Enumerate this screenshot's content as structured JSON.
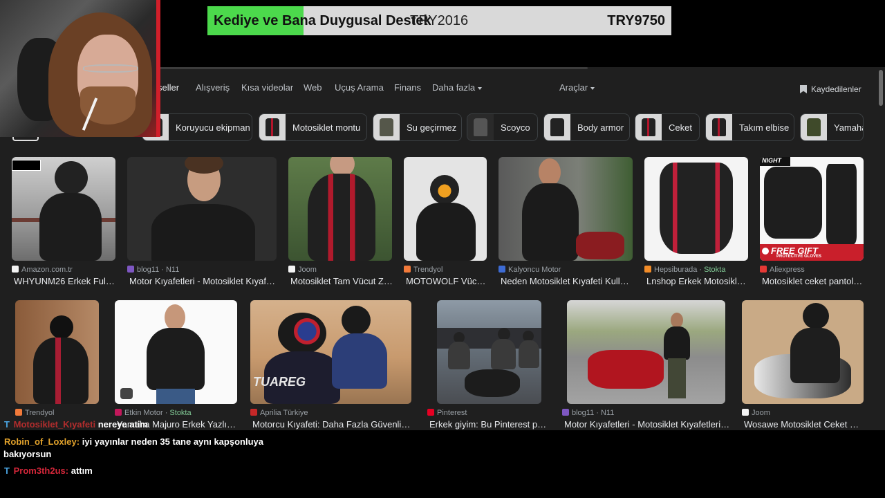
{
  "donation": {
    "title": "Kediye ve Bana Duygusal Destek",
    "raised": "TRY2016",
    "goal": "TRY9750",
    "progress": 0.207,
    "fill_color": "#4cd94c"
  },
  "tabs": {
    "items": [
      "seller",
      "Alışveriş",
      "Kısa videolar",
      "Web",
      "Uçuş Arama",
      "Finans",
      "Daha fazla"
    ],
    "tools": "Araçlar",
    "saved": "Kaydedilenler"
  },
  "chips": [
    "Koruyucu ekipman",
    "Motosiklet montu",
    "Su geçirmez",
    "Scoyco",
    "Body armor",
    "Ceket",
    "Takım elbise",
    "Yamaha"
  ],
  "row1": [
    {
      "source": "Amazon.com.tr",
      "caption": "WHYUNM26 Erkek Full ..."
    },
    {
      "source": "blog11 · N11",
      "caption": "Motor Kıyafetleri - Motosiklet Kıyafetl..."
    },
    {
      "source": "Joom",
      "caption": "Motosiklet Tam Vücut Zı..."
    },
    {
      "source": "Trendyol",
      "caption": "MOTOWOLF Vücu..."
    },
    {
      "source": "Kalyoncu Motor",
      "caption": "Neden Motosiklet Kıyafeti Kullan..."
    },
    {
      "source": "Hepsiburada",
      "stock": "Stokta",
      "caption": "Lnshop Erkek Motosiklet..."
    },
    {
      "source": "Aliexpress",
      "caption": "Motosiklet ceket pantolo...",
      "overlay_brand": "NIGHT",
      "overlay_badge": "FREE GIFT",
      "overlay_sub": "PROTECTIVE GLOVES"
    }
  ],
  "row2": [
    {
      "source": "Trendyol",
      "caption": ""
    },
    {
      "source": "Etkin Motor",
      "stock": "Stokta",
      "caption": "Yamaha Majuro Erkek Yazlık ..."
    },
    {
      "source": "Aprilia Türkiye",
      "caption": "Motorcu Kıyafeti: Daha Fazla Güvenlik ve...",
      "overlay_text": "TUAREG"
    },
    {
      "source": "Pinterest",
      "caption": "Erkek giyim: Bu Pinterest pan..."
    },
    {
      "source": "blog11 · N11",
      "caption": "Motor Kıyafetleri - Motosiklet Kıyafetleri Li..."
    },
    {
      "source": "Joom",
      "caption": "Wosawe Motosiklet Ceket Pa..."
    }
  ],
  "chat": [
    {
      "user": "Motosiklet_Kıyafeti",
      "text": "nereye atim"
    },
    {
      "user": "Robin_of_Loxley:",
      "text": "iyi yayınlar neden 35 tane aynı kapşonluya",
      "text2": "bakıyorsun"
    },
    {
      "user": "Prom3th2us:",
      "text": "attım"
    }
  ]
}
